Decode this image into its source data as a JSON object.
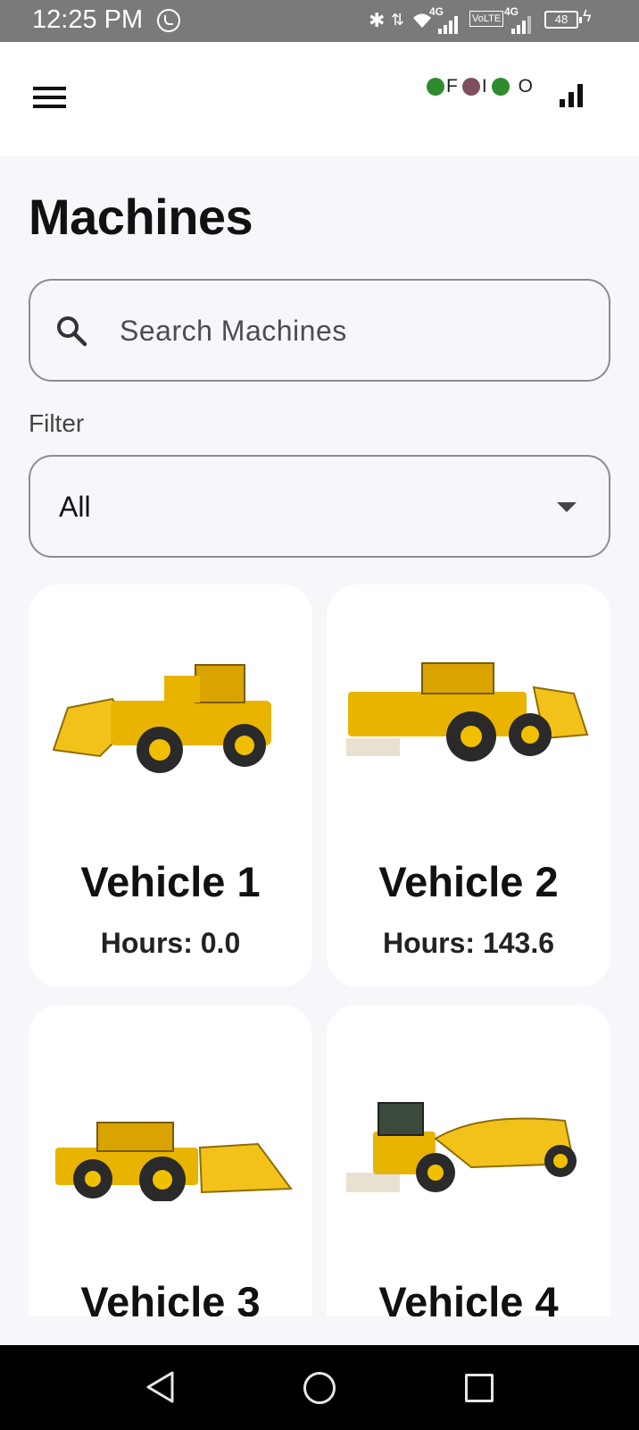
{
  "status_bar": {
    "time": "12:25 PM",
    "network_1": "4G",
    "volte": "VoLTE",
    "network_2": "4G",
    "battery": "48"
  },
  "app_bar": {
    "legend": [
      {
        "label": "F",
        "color": "#2e8b2e"
      },
      {
        "label": "I",
        "color": "#7d4f5f"
      },
      {
        "label": "O",
        "color": "#2e8b2e"
      }
    ]
  },
  "page": {
    "title": "Machines",
    "search_placeholder": "Search Machines",
    "filter_label": "Filter",
    "filter_value": "All"
  },
  "machines": [
    {
      "name": "Vehicle 1",
      "hours": "Hours: 0.0",
      "image": "wheel-loader-bucket-left"
    },
    {
      "name": "Vehicle 2",
      "hours": "Hours: 143.6",
      "image": "wheel-loader-bucket-right"
    },
    {
      "name": "Vehicle 3",
      "hours": "",
      "image": "wheel-loader-bucket-right-low"
    },
    {
      "name": "Vehicle 4",
      "hours": "",
      "image": "wheel-tractor-scraper"
    }
  ],
  "colors": {
    "machine_yellow": "#e8b400",
    "background": "#f5f7fa"
  }
}
